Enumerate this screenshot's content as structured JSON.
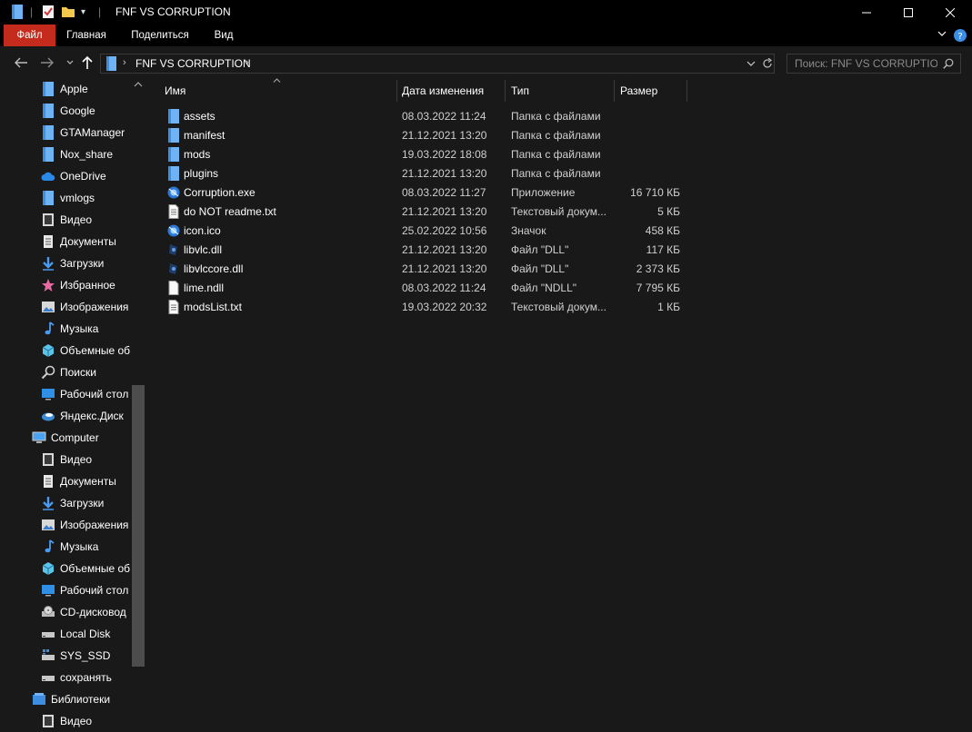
{
  "window": {
    "title": "FNF VS CORRUPTION"
  },
  "ribbon": {
    "tabs": [
      {
        "label": "Файл"
      },
      {
        "label": "Главная"
      },
      {
        "label": "Поделиться"
      },
      {
        "label": "Вид"
      }
    ]
  },
  "address": {
    "path": "FNF VS CORRUPTION",
    "search_placeholder": "Поиск: FNF VS CORRUPTION"
  },
  "columns": {
    "name": "Имя",
    "date": "Дата изменения",
    "type": "Тип",
    "size": "Размер"
  },
  "files": [
    {
      "name": "assets",
      "date": "08.03.2022 11:24",
      "type": "Папка с файлами",
      "size": "",
      "icon": "folder-icon"
    },
    {
      "name": "manifest",
      "date": "21.12.2021 13:20",
      "type": "Папка с файлами",
      "size": "",
      "icon": "folder-icon"
    },
    {
      "name": "mods",
      "date": "19.03.2022 18:08",
      "type": "Папка с файлами",
      "size": "",
      "icon": "folder-icon"
    },
    {
      "name": "plugins",
      "date": "21.12.2021 13:20",
      "type": "Папка с файлами",
      "size": "",
      "icon": "folder-icon"
    },
    {
      "name": "Corruption.exe",
      "date": "08.03.2022 11:27",
      "type": "Приложение",
      "size": "16 710 КБ",
      "icon": "app-icon"
    },
    {
      "name": "do NOT readme.txt",
      "date": "21.12.2021 13:20",
      "type": "Текстовый докум...",
      "size": "5 КБ",
      "icon": "text-file-icon"
    },
    {
      "name": "icon.ico",
      "date": "25.02.2022 10:56",
      "type": "Значок",
      "size": "458 КБ",
      "icon": "app-icon"
    },
    {
      "name": "libvlc.dll",
      "date": "21.12.2021 13:20",
      "type": "Файл \"DLL\"",
      "size": "117 КБ",
      "icon": "dll-icon"
    },
    {
      "name": "libvlccore.dll",
      "date": "21.12.2021 13:20",
      "type": "Файл \"DLL\"",
      "size": "2 373 КБ",
      "icon": "dll-icon"
    },
    {
      "name": "lime.ndll",
      "date": "08.03.2022 11:24",
      "type": "Файл \"NDLL\"",
      "size": "7 795 КБ",
      "icon": "generic-file-icon"
    },
    {
      "name": "modsList.txt",
      "date": "19.03.2022 20:32",
      "type": "Текстовый докум...",
      "size": "1 КБ",
      "icon": "text-file-icon"
    }
  ],
  "sidebar": [
    {
      "label": "Apple",
      "icon": "folder-icon",
      "indent": 1
    },
    {
      "label": "Google",
      "icon": "folder-icon",
      "indent": 1
    },
    {
      "label": "GTAManager",
      "icon": "folder-icon",
      "indent": 1
    },
    {
      "label": "Nox_share",
      "icon": "folder-icon",
      "indent": 1
    },
    {
      "label": "OneDrive",
      "icon": "cloud-icon",
      "indent": 1
    },
    {
      "label": "vmlogs",
      "icon": "folder-icon",
      "indent": 1
    },
    {
      "label": "Видео",
      "icon": "video-icon",
      "indent": 1
    },
    {
      "label": "Документы",
      "icon": "documents-icon",
      "indent": 1
    },
    {
      "label": "Загрузки",
      "icon": "download-icon",
      "indent": 1
    },
    {
      "label": "Избранное",
      "icon": "star-icon",
      "indent": 1
    },
    {
      "label": "Изображения",
      "icon": "pictures-icon",
      "indent": 1
    },
    {
      "label": "Музыка",
      "icon": "music-icon",
      "indent": 1
    },
    {
      "label": "Объемные об",
      "icon": "3d-objects-icon",
      "indent": 1
    },
    {
      "label": "Поиски",
      "icon": "search-icon",
      "indent": 1
    },
    {
      "label": "Рабочий стол",
      "icon": "desktop-icon",
      "indent": 1
    },
    {
      "label": "Яндекс.Диск",
      "icon": "yandex-disk-icon",
      "indent": 1
    },
    {
      "label": "Computer",
      "icon": "computer-icon",
      "indent": 0
    },
    {
      "label": "Видео",
      "icon": "video-icon",
      "indent": 1
    },
    {
      "label": "Документы",
      "icon": "documents-icon",
      "indent": 1
    },
    {
      "label": "Загрузки",
      "icon": "download-icon",
      "indent": 1
    },
    {
      "label": "Изображения",
      "icon": "pictures-icon",
      "indent": 1
    },
    {
      "label": "Музыка",
      "icon": "music-icon",
      "indent": 1
    },
    {
      "label": "Объемные об",
      "icon": "3d-objects-icon",
      "indent": 1
    },
    {
      "label": "Рабочий стол",
      "icon": "desktop-icon",
      "indent": 1
    },
    {
      "label": "CD-дисковод",
      "icon": "cd-drive-icon",
      "indent": 1
    },
    {
      "label": "Local Disk",
      "icon": "drive-icon",
      "indent": 1
    },
    {
      "label": "SYS_SSD",
      "icon": "system-drive-icon",
      "indent": 1
    },
    {
      "label": "сохранять",
      "icon": "drive-icon",
      "indent": 1
    },
    {
      "label": "Библиотеки",
      "icon": "libraries-icon",
      "indent": 0
    },
    {
      "label": "Видео",
      "icon": "video-icon",
      "indent": 1
    }
  ],
  "colors": {
    "background": "#191919",
    "titlebar": "#000000",
    "file_tab": "#c42b1c",
    "folder": "#6fb3f5"
  }
}
